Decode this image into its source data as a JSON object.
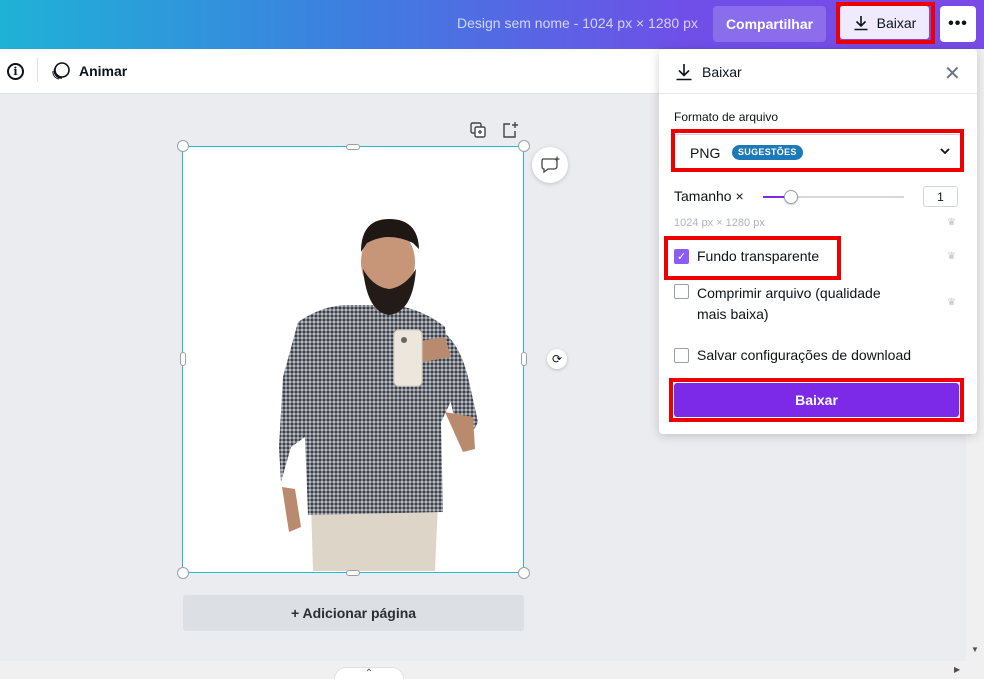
{
  "header": {
    "design_title": "Design sem nome - 1024 px × 1280 px",
    "share_label": "Compartilhar",
    "download_label": "Baixar",
    "more_label": "•••"
  },
  "toolbar": {
    "animate_label": "Animar",
    "info_symbol": "i"
  },
  "canvas": {
    "add_page_label": "+ Adicionar página"
  },
  "download_panel": {
    "title": "Baixar",
    "file_format_label": "Formato de arquivo",
    "file_format_value": "PNG",
    "file_format_badge": "SUGESTÕES",
    "size_label": "Tamanho ×",
    "size_value": "1",
    "size_slider_fraction": 0.2,
    "dimensions": "1024 px × 1280 px",
    "options": [
      {
        "label": "Fundo transparente",
        "checked": true
      },
      {
        "label": "Comprimir arquivo (qualidade mais baixa)",
        "checked": false
      },
      {
        "label": "Salvar configurações de download",
        "checked": false
      }
    ],
    "download_button_label": "Baixar"
  },
  "colors": {
    "accent": "#7d2ae8",
    "highlight": "#e00000",
    "selection": "#27b8d2"
  }
}
